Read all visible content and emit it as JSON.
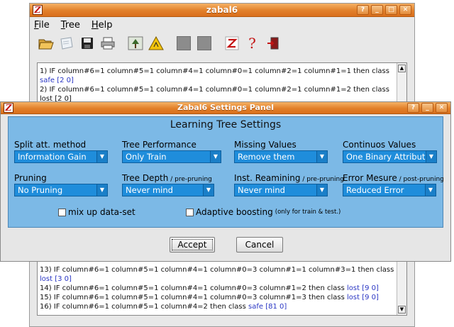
{
  "main_window": {
    "title": "zabal6",
    "app_icon_glyph": "Z",
    "menu": [
      "File",
      "Tree",
      "Help"
    ],
    "toolbar_icons": [
      "open-folder-icon",
      "sticky-note-icon",
      "save-disk-icon",
      "printer-icon",
      "tree-image-icon",
      "warning-sign-icon",
      "gray-square-icon",
      "gray-square-icon",
      "zabal-logo-icon",
      "help-question-icon",
      "exit-door-icon"
    ]
  },
  "log_top": [
    {
      "text": "1) IF column#6=1 column#5=1 column#4=1 column#0=1 column#2=1 column#1=1 then class ",
      "cls": "safe",
      "vals": "[2 0]"
    },
    {
      "text": "2) IF column#6=1 column#5=1 column#4=1 column#0=1 column#2=1 column#1=2 then class ",
      "cls": "",
      "vals": ""
    },
    {
      "text": "lost [2 0]",
      "cls": "",
      "vals": ""
    }
  ],
  "log_bottom": [
    {
      "text": "13) IF column#6=1 column#5=1 column#4=1 column#0=3 column#1=1 column#3=1 then class",
      "cls": "",
      "vals": ""
    },
    {
      "text": "",
      "cls": "lost",
      "vals": "[3 0]"
    },
    {
      "text": "14) IF column#6=1 column#5=1 column#4=1 column#0=3 column#1=2 then class ",
      "cls": "lost",
      "vals": "[9 0]"
    },
    {
      "text": "15) IF column#6=1 column#5=1 column#4=1 column#0=3 column#1=3 then class ",
      "cls": "lost",
      "vals": "[9 0]"
    },
    {
      "text": "16) IF column#6=1 column#5=1 column#4=2 then class ",
      "cls": "safe",
      "vals": "[81 0]"
    }
  ],
  "dialog": {
    "title": "Zabal6 Settings Panel",
    "heading": "Learning Tree Settings",
    "fields": {
      "split": {
        "label": "Split att. method",
        "note": "",
        "value": "Information Gain"
      },
      "performance": {
        "label": "Tree Performance",
        "note": "",
        "value": "Only Train"
      },
      "missing": {
        "label": "Missing Values",
        "note": "",
        "value": "Remove them"
      },
      "continuous": {
        "label": "Continuos Values",
        "note": "",
        "value": "One Binary Attribute"
      },
      "pruning": {
        "label": "Pruning",
        "note": "",
        "value": "No Pruning"
      },
      "depth": {
        "label": "Tree Depth",
        "note": " / pre-pruning",
        "value": "Never mind"
      },
      "reamining": {
        "label": "Inst. Reamining",
        "note": " / pre-pruning",
        "value": "Never mind"
      },
      "error": {
        "label": "Error Mesure",
        "note": " / post-pruning",
        "value": "Reduced Error"
      }
    },
    "mixup_label": "mix up data-set",
    "boost_label": "Adaptive boosting",
    "boost_note": "(only for train & test.)",
    "accept_label": "Accept",
    "cancel_label": "Cancel"
  },
  "colors": {
    "titlebar": "#e2802a",
    "panel": "#7cb9e6",
    "combo": "#1f8ddb",
    "class_text": "#2a36c4"
  }
}
